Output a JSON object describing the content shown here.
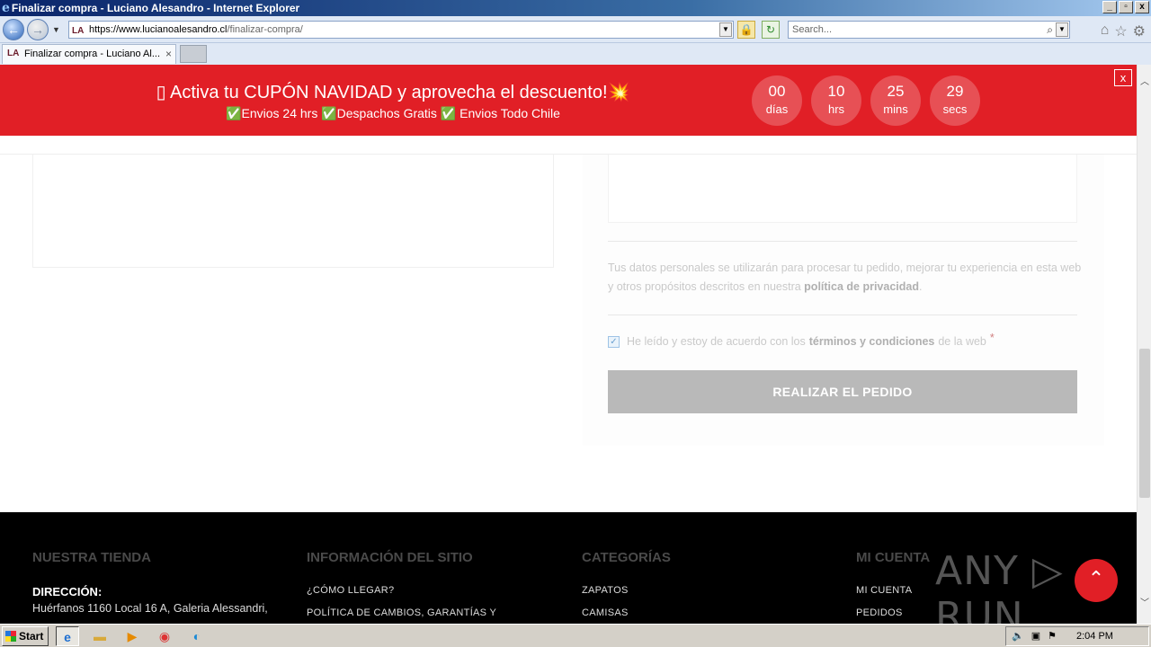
{
  "window": {
    "title": "Finalizar compra - Luciano Alesandro - Internet Explorer",
    "ie_glyph": "e",
    "min": "_",
    "max": "▫",
    "close": "x"
  },
  "address_bar": {
    "favicon": "LA",
    "url_host": "https://www.lucianoalesandro.cl",
    "url_path": "/finalizar-compra/",
    "search_placeholder": "Search...",
    "back_glyph": "←",
    "fwd_glyph": "→",
    "dropdown_glyph": "▼",
    "lock_glyph": "🔒",
    "refresh_glyph": "↻",
    "search_glyph": "⌕",
    "home_glyph": "⌂",
    "star_glyph": "☆",
    "gear_glyph": "⚙"
  },
  "tabs": [
    {
      "favicon": "LA",
      "label": "Finalizar compra - Luciano Al...",
      "close": "×"
    }
  ],
  "promo": {
    "line1": "▯ Activa tu CUPÓN NAVIDAD y aprovecha el descuento!💥",
    "line2": "✅Envios 24 hrs ✅Despachos Gratis ✅ Envios Todo Chile",
    "close": "x",
    "countdown": [
      {
        "num": "00",
        "unit": "días"
      },
      {
        "num": "10",
        "unit": "hrs"
      },
      {
        "num": "25",
        "unit": "mins"
      },
      {
        "num": "29",
        "unit": "secs"
      }
    ]
  },
  "checkout": {
    "privacy_text": "Tus datos personales se utilizarán para procesar tu pedido, mejorar tu experiencia en esta web y otros propósitos descritos en nuestra ",
    "privacy_link": "política de privacidad",
    "privacy_end": ".",
    "terms_pre": "He leído y estoy de acuerdo con los",
    "terms_link": "términos y condiciones",
    "terms_post": "de la web",
    "terms_req": "*",
    "terms_checked": true,
    "order_button": "REALIZAR EL PEDIDO"
  },
  "footer": {
    "columns": [
      {
        "title": "NUESTRA TIENDA",
        "address_label": "DIRECCIÓN:",
        "address": "Huérfanos 1160 Local 16 A, Galeria Alessandri,"
      },
      {
        "title": "INFORMACIÓN DEL SITIO",
        "items": [
          "¿CÓMO LLEGAR?",
          "POLÍTICA DE CAMBIOS, GARANTÍAS Y"
        ]
      },
      {
        "title": "CATEGORÍAS",
        "items": [
          "ZAPATOS",
          "CAMISAS"
        ]
      },
      {
        "title": "MI CUENTA",
        "items": [
          "MI CUENTA",
          "PEDIDOS"
        ]
      }
    ],
    "watermark": "ANY ▷ RUN",
    "to_top_glyph": "⌃"
  },
  "taskbar": {
    "start": "Start",
    "clock": "2:04 PM"
  },
  "colors": {
    "promo_red": "#e11f26",
    "footer_bg": "#000000",
    "button_grey": "#b9b9b9"
  }
}
